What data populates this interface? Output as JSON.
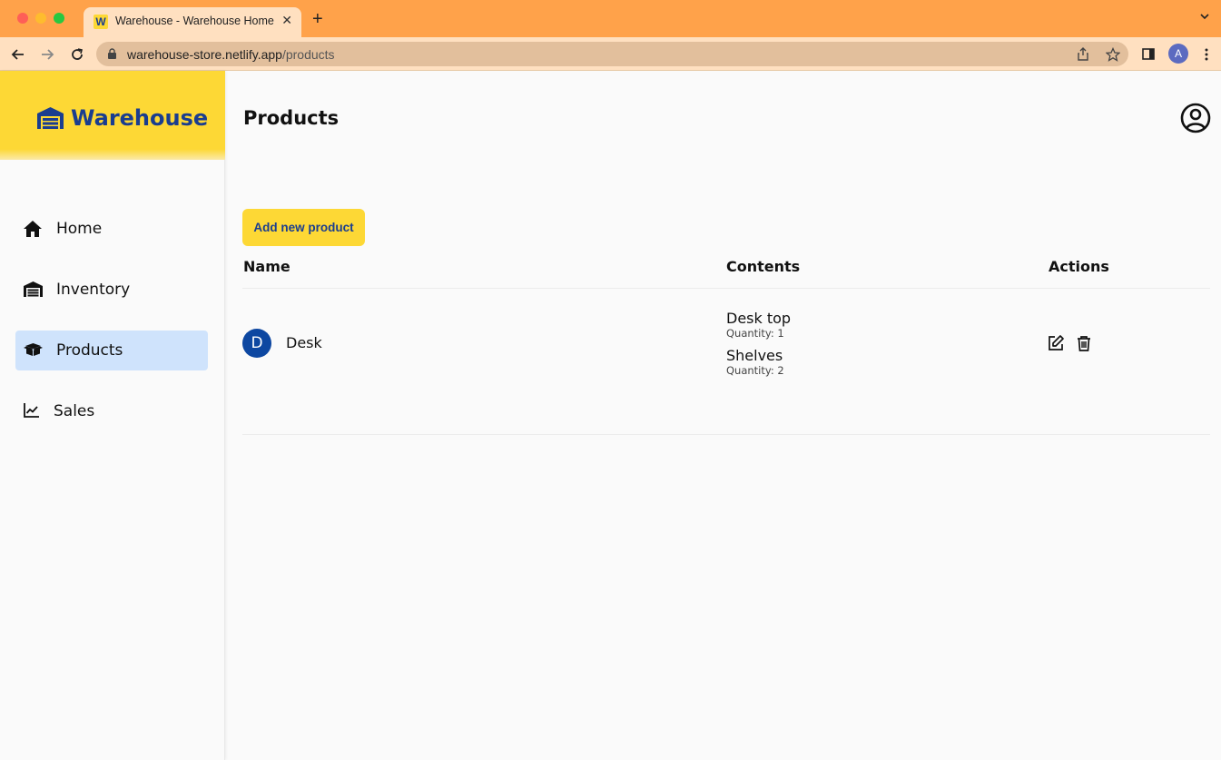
{
  "browser": {
    "tab_title": "Warehouse - Warehouse Home",
    "tab_favicon": "W",
    "url_host": "warehouse-store.netlify.app",
    "url_path": "/products",
    "profile_initial": "A"
  },
  "sidebar": {
    "brand": "Warehouse",
    "items": [
      {
        "label": "Home",
        "icon": "home-icon"
      },
      {
        "label": "Inventory",
        "icon": "warehouse-icon"
      },
      {
        "label": "Products",
        "icon": "box-icon",
        "active": true
      },
      {
        "label": "Sales",
        "icon": "chart-line-icon"
      }
    ]
  },
  "main": {
    "title": "Products",
    "add_button": "Add new product",
    "columns": [
      "Name",
      "Contents",
      "Actions"
    ],
    "rows": [
      {
        "initial": "D",
        "name": "Desk",
        "contents": [
          {
            "name": "Desk top",
            "quantity": "Quantity: 1"
          },
          {
            "name": "Shelves",
            "quantity": "Quantity: 2"
          }
        ]
      }
    ]
  },
  "colors": {
    "brand_yellow": "#fdd835",
    "brand_blue": "#1a3d8f",
    "active_nav": "#cfe3fc",
    "browser_orange": "#ffa24a"
  }
}
